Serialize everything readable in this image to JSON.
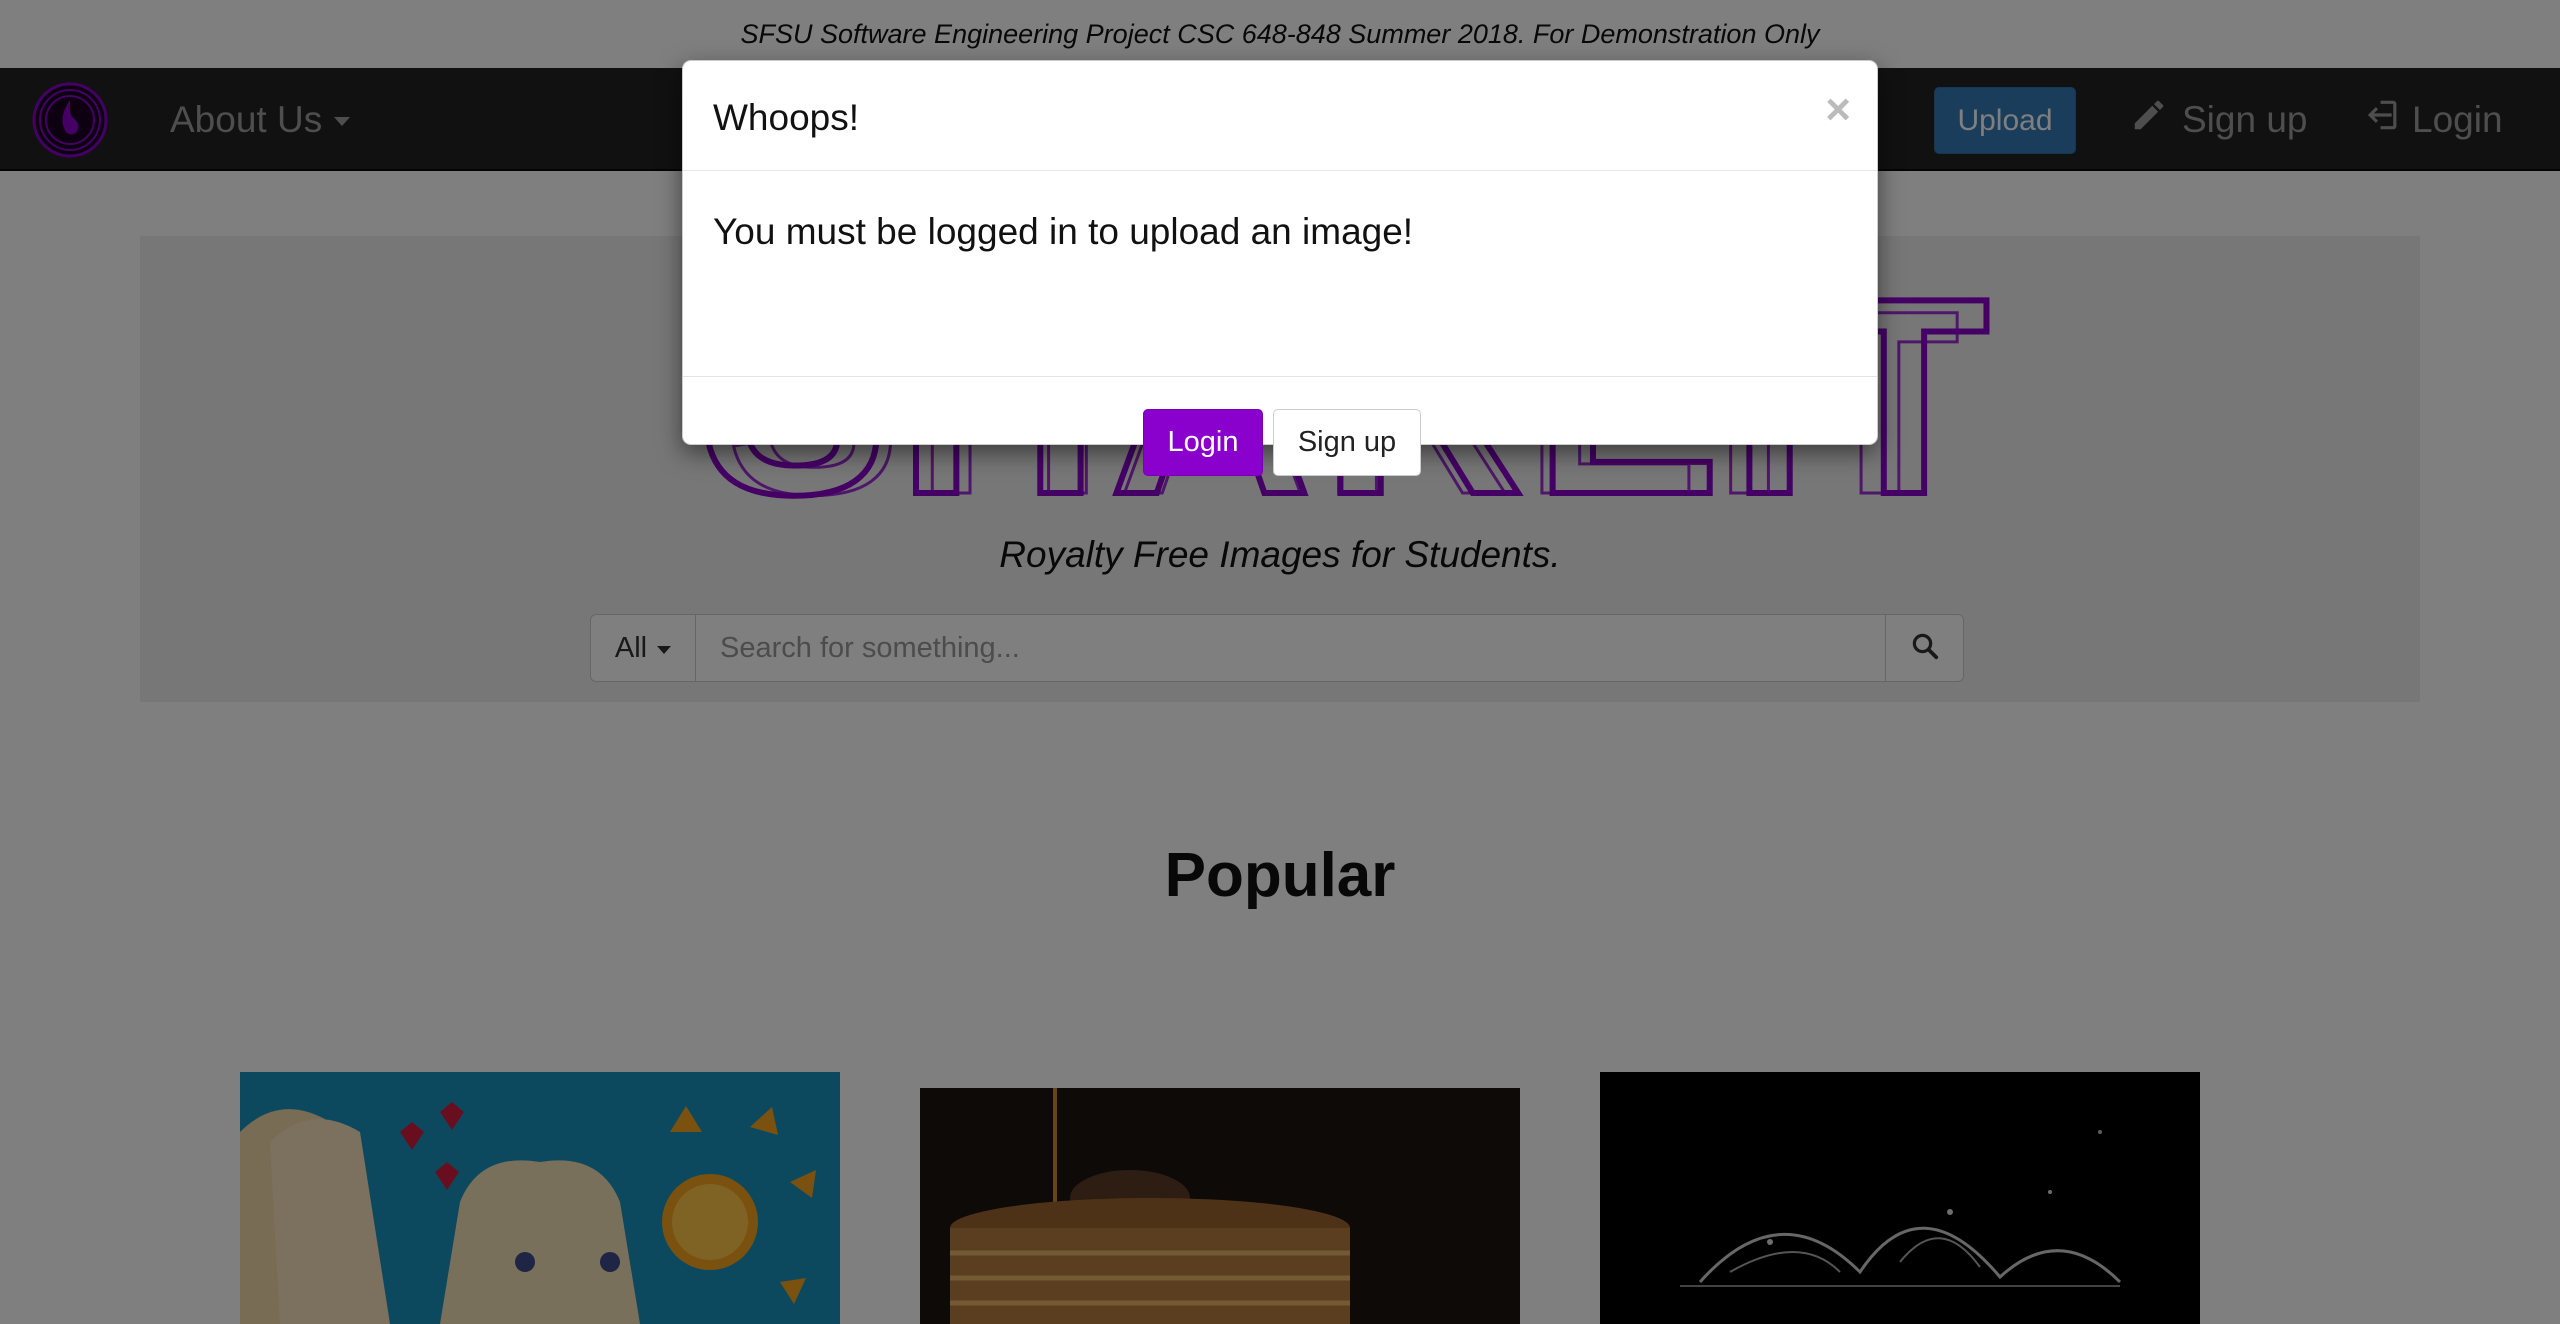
{
  "banner": {
    "text": "SFSU Software Engineering Project CSC 648-848 Summer 2018. For Demonstration Only"
  },
  "navbar": {
    "about_label": "About Us",
    "upload_label": "Upload",
    "signup_label": "Sign up",
    "login_label": "Login"
  },
  "hero": {
    "logo_text": "SHAREIT",
    "tagline": "Royalty Free Images for Students.",
    "search": {
      "filter_label": "All",
      "placeholder": "Search for something..."
    }
  },
  "main": {
    "section_title": "Popular",
    "thumbnails": [
      "bread-with-fruit-face",
      "stacked-pancakes-with-syrup",
      "water-splash-on-black"
    ]
  },
  "modal": {
    "title": "Whoops!",
    "close_label": "×",
    "message": "You must be logged in to upload an image!",
    "login_label": "Login",
    "signup_label": "Sign up"
  },
  "colors": {
    "brand_purple": "#8a00cc",
    "navbar_bg": "#222222",
    "upload_blue": "#337ab7"
  }
}
